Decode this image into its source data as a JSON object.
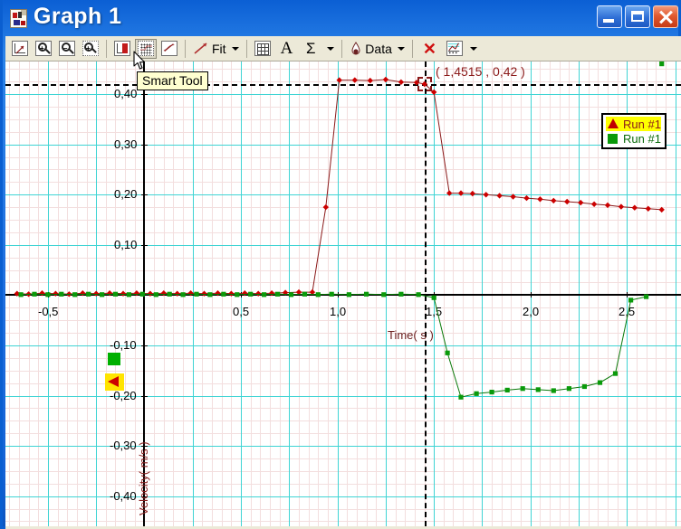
{
  "window": {
    "title": "Graph 1",
    "icon": "graph-document-icon",
    "buttons": {
      "minimize": "Minimize",
      "maximize": "Maximize",
      "close": "Close"
    }
  },
  "toolbar": {
    "items": [
      {
        "name": "autoscale-button",
        "icon": "autoscale-icon",
        "label": ""
      },
      {
        "name": "zoom-in-button",
        "icon": "zoom-in-icon",
        "label": ""
      },
      {
        "name": "zoom-out-button",
        "icon": "zoom-out-icon",
        "label": ""
      },
      {
        "name": "zoom-select-button",
        "icon": "zoom-select-icon",
        "label": ""
      },
      {
        "name": "scale-lock-button",
        "icon": "scale-lock-icon",
        "label": ""
      },
      {
        "name": "smart-tool-button",
        "icon": "smart-tool-icon",
        "label": ""
      },
      {
        "name": "slope-tool-button",
        "icon": "slope-tool-icon",
        "label": ""
      },
      {
        "name": "fit-button",
        "icon": "fit-line-icon",
        "label": "Fit"
      },
      {
        "name": "calculator-button",
        "icon": "calculator-icon",
        "label": ""
      },
      {
        "name": "text-annotation-button",
        "icon": "text-a-icon",
        "label": ""
      },
      {
        "name": "statistics-button",
        "icon": "sigma-icon",
        "label": ""
      },
      {
        "name": "data-button",
        "icon": "data-drop-icon",
        "label": "Data"
      },
      {
        "name": "remove-button",
        "icon": "red-x-icon",
        "label": ""
      },
      {
        "name": "graph-settings-button",
        "icon": "graph-settings-icon",
        "label": ""
      }
    ],
    "tooltip": "Smart Tool"
  },
  "chart_data": {
    "type": "line",
    "title": "",
    "xlabel": "Time( s )",
    "ylabel": "Velocity( m/s )",
    "xlim": [
      -0.72,
      2.78
    ],
    "ylim": [
      -0.46,
      0.465
    ],
    "xticks": [
      "-0,5",
      "0,5",
      "1,0",
      "1,5",
      "2,0",
      "2,5"
    ],
    "xtick_values": [
      -0.5,
      0.5,
      1.0,
      1.5,
      2.0,
      2.5
    ],
    "yticks": [
      "0,40",
      "0,30",
      "0,20",
      "0,10",
      "-0,10",
      "-0,20",
      "-0,30",
      "-0,40"
    ],
    "ytick_values": [
      0.4,
      0.3,
      0.2,
      0.1,
      -0.1,
      -0.2,
      -0.3,
      -0.4
    ],
    "grid": true,
    "grid_major_color": "#3fd4d4",
    "grid_minor_color": "#f3dede",
    "legend_position": "right-top",
    "annotation": "( 1,4515 , 0,42 )",
    "crosshair": {
      "x": 1.4515,
      "y": 0.42
    },
    "series": [
      {
        "name": "Run #1",
        "color": "#8b1a1a",
        "marker": "triangle",
        "marker_color": "#cc0000",
        "x": [
          -0.66,
          -0.6,
          -0.53,
          -0.46,
          -0.39,
          -0.32,
          -0.25,
          -0.18,
          -0.11,
          -0.04,
          0.03,
          0.1,
          0.17,
          0.24,
          0.31,
          0.38,
          0.45,
          0.52,
          0.59,
          0.66,
          0.73,
          0.8,
          0.87,
          0.94,
          1.01,
          1.09,
          1.17,
          1.25,
          1.33,
          1.41,
          1.4515,
          1.5,
          1.58,
          1.64,
          1.7,
          1.77,
          1.84,
          1.91,
          1.98,
          2.05,
          2.12,
          2.19,
          2.26,
          2.33,
          2.4,
          2.47,
          2.54,
          2.61,
          2.68
        ],
        "y": [
          0.003,
          0.002,
          0.004,
          0.003,
          0.002,
          0.004,
          0.003,
          0.004,
          0.003,
          0.004,
          0.003,
          0.004,
          0.003,
          0.004,
          0.003,
          0.004,
          0.003,
          0.004,
          0.003,
          0.004,
          0.005,
          0.006,
          0.006,
          0.175,
          0.428,
          0.428,
          0.427,
          0.429,
          0.424,
          0.423,
          0.42,
          0.404,
          0.203,
          0.203,
          0.202,
          0.2,
          0.198,
          0.196,
          0.193,
          0.191,
          0.188,
          0.186,
          0.184,
          0.181,
          0.179,
          0.176,
          0.174,
          0.172,
          0.17
        ]
      },
      {
        "name": "Run #1",
        "color": "#0a7a0a",
        "marker": "square",
        "marker_color": "#0a9a0a",
        "x": [
          -0.64,
          -0.57,
          -0.5,
          -0.43,
          -0.36,
          -0.29,
          -0.22,
          -0.15,
          -0.08,
          -0.01,
          0.06,
          0.13,
          0.2,
          0.27,
          0.34,
          0.41,
          0.48,
          0.55,
          0.62,
          0.69,
          0.76,
          0.83,
          0.9,
          0.97,
          1.06,
          1.15,
          1.24,
          1.33,
          1.42,
          1.5,
          1.57,
          1.64,
          1.72,
          1.8,
          1.88,
          1.96,
          2.04,
          2.12,
          2.2,
          2.28,
          2.36,
          2.44,
          2.52,
          2.6,
          2.68
        ],
        "y": [
          0.001,
          0.002,
          0.001,
          0.002,
          0.001,
          0.002,
          0.001,
          0.002,
          0.001,
          0.002,
          0.001,
          0.002,
          0.001,
          0.002,
          0.001,
          0.002,
          0.001,
          0.002,
          0.001,
          0.002,
          0.001,
          0.002,
          0.001,
          0.002,
          0.001,
          0.002,
          0.001,
          0.002,
          0.001,
          -0.005,
          -0.115,
          -0.203,
          -0.196,
          -0.193,
          -0.189,
          -0.186,
          -0.188,
          -0.19,
          -0.186,
          -0.182,
          -0.174,
          -0.156,
          -0.01,
          -0.003
        ]
      }
    ]
  },
  "legend": {
    "entries": [
      {
        "label": "Run #1",
        "symbol": "triangle",
        "highlighted": true
      },
      {
        "label": "Run #1",
        "symbol": "square",
        "highlighted": false
      }
    ]
  },
  "axis_markers": [
    {
      "name": "green-square-marker",
      "symbol": "square"
    },
    {
      "name": "yellow-triangle-marker",
      "symbol": "triangle"
    }
  ],
  "colors": {
    "titlebar": "#1f6fdf",
    "toolbar": "#ece9d8",
    "grid_major": "#3fd4d4",
    "grid_minor": "#f3dede",
    "series_red": "#8b1a1a",
    "series_green": "#0a7a0a",
    "tooltip_bg": "#ffffd0",
    "highlight": "#ffff00"
  }
}
